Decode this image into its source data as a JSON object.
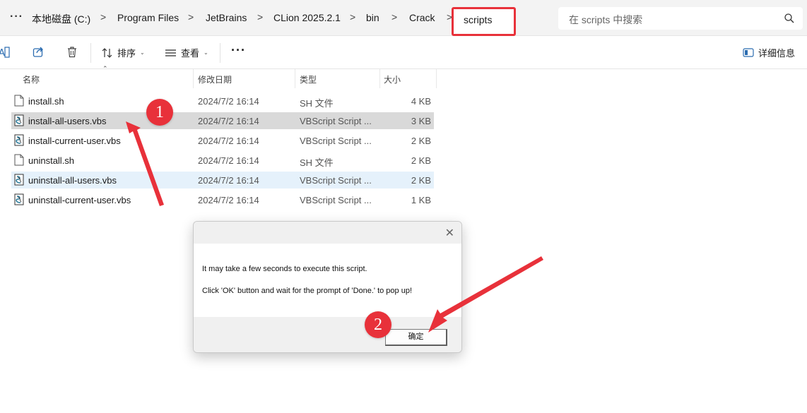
{
  "address_bar": {
    "more_label": "···",
    "breadcrumbs": [
      "本地磁盘 (C:)",
      "Program Files",
      "JetBrains",
      "CLion 2025.2.1",
      "bin",
      "Crack"
    ],
    "separator": ">",
    "current_folder": "scripts",
    "search_placeholder": "在 scripts 中搜索"
  },
  "toolbar": {
    "sort_label": "排序",
    "view_label": "查看",
    "more_label": "···",
    "details_label": "详细信息"
  },
  "columns": {
    "name": "名称",
    "date": "修改日期",
    "type": "类型",
    "size": "大小"
  },
  "files": [
    {
      "name": "install.sh",
      "date": "2024/7/2 16:14",
      "type": "SH 文件",
      "size": "4 KB",
      "icon": "text-file-icon"
    },
    {
      "name": "install-all-users.vbs",
      "date": "2024/7/2 16:14",
      "type": "VBScript Script ...",
      "size": "3 KB",
      "icon": "vbs-script-icon"
    },
    {
      "name": "install-current-user.vbs",
      "date": "2024/7/2 16:14",
      "type": "VBScript Script ...",
      "size": "2 KB",
      "icon": "vbs-script-icon"
    },
    {
      "name": "uninstall.sh",
      "date": "2024/7/2 16:14",
      "type": "SH 文件",
      "size": "2 KB",
      "icon": "text-file-icon"
    },
    {
      "name": "uninstall-all-users.vbs",
      "date": "2024/7/2 16:14",
      "type": "VBScript Script ...",
      "size": "2 KB",
      "icon": "vbs-script-icon"
    },
    {
      "name": "uninstall-current-user.vbs",
      "date": "2024/7/2 16:14",
      "type": "VBScript Script ...",
      "size": "1 KB",
      "icon": "vbs-script-icon"
    }
  ],
  "dialog": {
    "close_label": "✕",
    "message_line1": "It may take a few seconds to execute this script.",
    "message_line2": "Click 'OK' button and wait for the prompt of 'Done.' to pop up!",
    "ok_label": "确定"
  },
  "annotations": {
    "marker1": "1",
    "marker2": "2",
    "color": "#e8313a"
  }
}
